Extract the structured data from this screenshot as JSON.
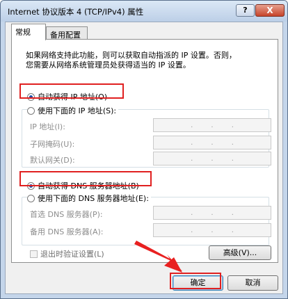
{
  "window": {
    "title": "Internet 协议版本 4 (TCP/IPv4) 属性",
    "help_label": "?",
    "close_label": "X"
  },
  "tabs": [
    {
      "label": "常规"
    },
    {
      "label": "备用配置"
    }
  ],
  "description": {
    "line1": "如果网络支持此功能，则可以获取自动指派的 IP 设置。否则，",
    "line2": "您需要从网络系统管理员处获得适当的 IP 设置。"
  },
  "ip_section": {
    "auto_label": "自动获得 IP 地址(O)",
    "manual_label": "使用下面的 IP 地址(S):",
    "selected": "auto",
    "fields": [
      {
        "label": "IP 地址(I):"
      },
      {
        "label": "子网掩码(U):"
      },
      {
        "label": "默认网关(D):"
      }
    ]
  },
  "dns_section": {
    "auto_label": "自动获得 DNS 服务器地址(B)",
    "manual_label": "使用下面的 DNS 服务器地址(E):",
    "selected": "auto",
    "fields": [
      {
        "label": "首选 DNS 服务器(P):"
      },
      {
        "label": "备用 DNS 服务器(A):"
      }
    ]
  },
  "ip_dot": ".",
  "validate_label": "退出时验证设置(L)",
  "advanced_label": "高级(V)...",
  "ok_label": "确定",
  "cancel_label": "取消",
  "annotation_color": "#e02020"
}
